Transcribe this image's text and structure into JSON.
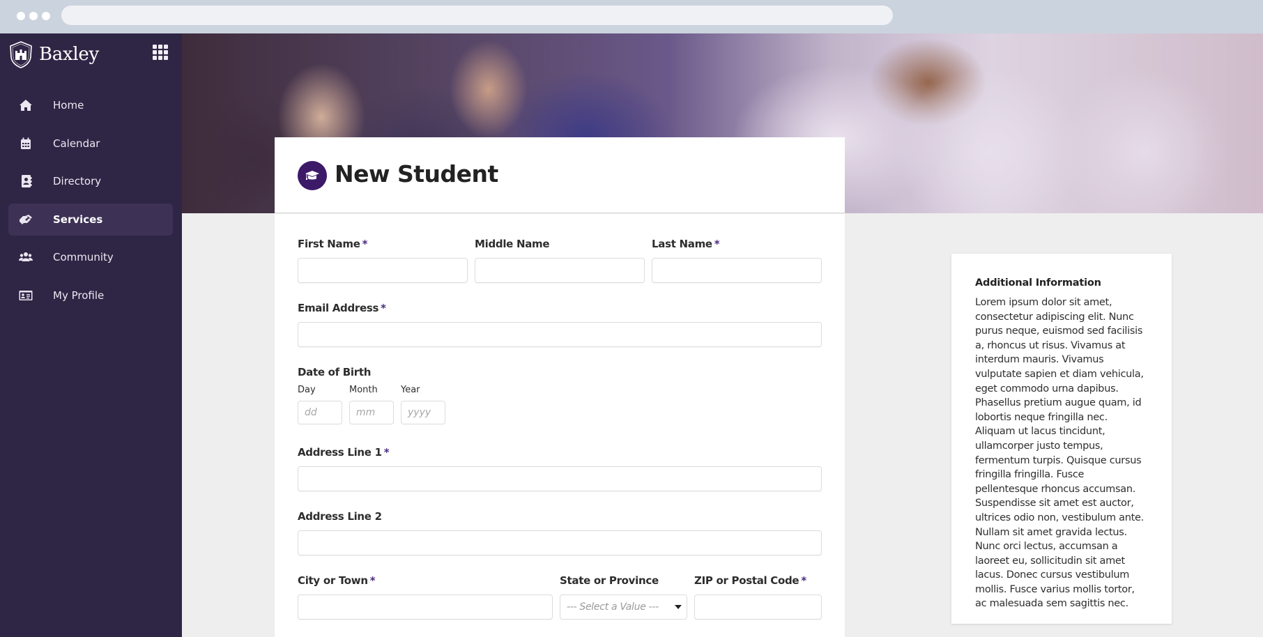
{
  "browser": {
    "window_dots": 3
  },
  "sidebar": {
    "brand": "Baxley",
    "apps_icon": "grid-icon",
    "items": [
      {
        "label": "Home",
        "icon": "home-icon",
        "active": false
      },
      {
        "label": "Calendar",
        "icon": "calendar-icon",
        "active": false
      },
      {
        "label": "Directory",
        "icon": "address-book-icon",
        "active": false
      },
      {
        "label": "Services",
        "icon": "handshake-icon",
        "active": true
      },
      {
        "label": "Community",
        "icon": "users-icon",
        "active": false
      },
      {
        "label": "My Profile",
        "icon": "id-card-icon",
        "active": false
      }
    ]
  },
  "hero": {
    "description": "graduation ceremony photo banner"
  },
  "form": {
    "title": "New Student",
    "title_icon": "graduation-cap-icon",
    "required_marker": "*",
    "fields": {
      "first_name": {
        "label": "First Name",
        "required": true,
        "value": ""
      },
      "middle_name": {
        "label": "Middle Name",
        "required": false,
        "value": ""
      },
      "last_name": {
        "label": "Last Name",
        "required": true,
        "value": ""
      },
      "email": {
        "label": "Email Address",
        "required": true,
        "value": ""
      },
      "dob": {
        "label": "Date of Birth",
        "day": {
          "label": "Day",
          "placeholder": "dd"
        },
        "month": {
          "label": "Month",
          "placeholder": "mm"
        },
        "year": {
          "label": "Year",
          "placeholder": "yyyy"
        }
      },
      "address1": {
        "label": "Address Line 1",
        "required": true,
        "value": ""
      },
      "address2": {
        "label": "Address Line 2",
        "required": false,
        "value": ""
      },
      "city": {
        "label": "City or Town",
        "required": true,
        "value": ""
      },
      "state": {
        "label": "State or Province",
        "required": false,
        "selected": "--- Select a Value ---"
      },
      "zip": {
        "label": "ZIP or Postal Code",
        "required": true,
        "value": ""
      }
    }
  },
  "info": {
    "title": "Additional Information",
    "text": "Lorem ipsum dolor sit amet, consectetur adipiscing elit. Nunc purus neque, euismod sed facilisis a, rhoncus ut risus. Vivamus at interdum mauris. Vivamus vulputate sapien et diam vehicula, eget commodo urna dapibus. Phasellus pretium augue quam, id lobortis neque fringilla nec. Aliquam ut lacus tincidunt, ullamcorper justo tempus, fermentum turpis. Quisque cursus fringilla fringilla. Fusce pellentesque rhoncus accumsan. Suspendisse sit amet est auctor, ultrices odio non, vestibulum ante. Nullam sit amet gravida lectus. Nunc orci lectus, accumsan a laoreet eu, sollicitudin sit amet lacus. Donec cursus vestibulum mollis. Fusce varius mollis tortor, ac malesuada sem sagittis nec."
  }
}
